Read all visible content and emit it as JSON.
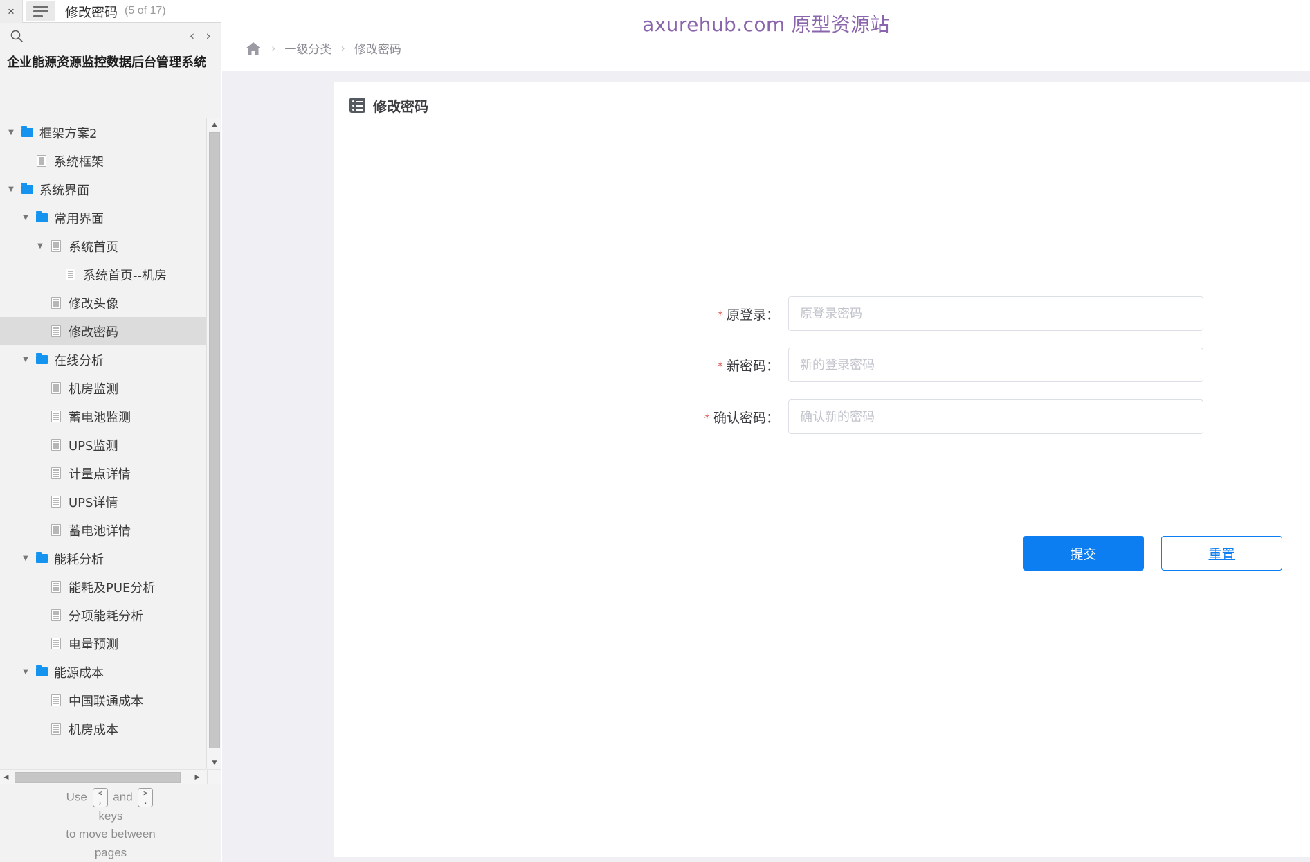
{
  "host": {
    "close_label": "×",
    "menu_icon": "hamburger-icon",
    "page_title": "修改密码",
    "page_count": "(5 of 17)",
    "prev_arrow": "‹",
    "next_arrow": "›",
    "search_icon": "search-icon"
  },
  "sidebar": {
    "app_title": "企业能源资源监控数据后台管理系统",
    "tree": [
      {
        "label": "框架方案2",
        "type": "folder",
        "depth": 0,
        "twisty": "▼",
        "selected": false
      },
      {
        "label": "系统框架",
        "type": "page",
        "depth": 1,
        "twisty": "",
        "selected": false
      },
      {
        "label": "系统界面",
        "type": "folder",
        "depth": 0,
        "twisty": "▼",
        "selected": false
      },
      {
        "label": "常用界面",
        "type": "folder",
        "depth": 1,
        "twisty": "▼",
        "selected": false
      },
      {
        "label": "系统首页",
        "type": "page",
        "depth": 2,
        "twisty": "▼",
        "selected": false
      },
      {
        "label": "系统首页--机房",
        "type": "page",
        "depth": 3,
        "twisty": "",
        "selected": false
      },
      {
        "label": "修改头像",
        "type": "page",
        "depth": 2,
        "twisty": "",
        "selected": false
      },
      {
        "label": "修改密码",
        "type": "page",
        "depth": 2,
        "twisty": "",
        "selected": true
      },
      {
        "label": "在线分析",
        "type": "folder",
        "depth": 1,
        "twisty": "▼",
        "selected": false
      },
      {
        "label": "机房监测",
        "type": "page",
        "depth": 2,
        "twisty": "",
        "selected": false
      },
      {
        "label": "蓄电池监测",
        "type": "page",
        "depth": 2,
        "twisty": "",
        "selected": false
      },
      {
        "label": "UPS监测",
        "type": "page",
        "depth": 2,
        "twisty": "",
        "selected": false
      },
      {
        "label": "计量点详情",
        "type": "page",
        "depth": 2,
        "twisty": "",
        "selected": false
      },
      {
        "label": "UPS详情",
        "type": "page",
        "depth": 2,
        "twisty": "",
        "selected": false
      },
      {
        "label": "蓄电池详情",
        "type": "page",
        "depth": 2,
        "twisty": "",
        "selected": false
      },
      {
        "label": "能耗分析",
        "type": "folder",
        "depth": 1,
        "twisty": "▼",
        "selected": false
      },
      {
        "label": "能耗及PUE分析",
        "type": "page",
        "depth": 2,
        "twisty": "",
        "selected": false
      },
      {
        "label": "分项能耗分析",
        "type": "page",
        "depth": 2,
        "twisty": "",
        "selected": false
      },
      {
        "label": "电量预测",
        "type": "page",
        "depth": 2,
        "twisty": "",
        "selected": false
      },
      {
        "label": "能源成本",
        "type": "folder",
        "depth": 1,
        "twisty": "▼",
        "selected": false
      },
      {
        "label": "中国联通成本",
        "type": "page",
        "depth": 2,
        "twisty": "",
        "selected": false
      },
      {
        "label": "机房成本",
        "type": "page",
        "depth": 2,
        "twisty": "",
        "selected": false
      }
    ],
    "footer": {
      "use": "Use",
      "key_prev_top": "<",
      "key_prev_bottom": ",",
      "and": "and",
      "key_next_top": ">",
      "key_next_bottom": ".",
      "keys": "keys",
      "line3": "to move between",
      "line4": "pages"
    },
    "scroll": {
      "up": "▲",
      "down": "▼",
      "left": "◀",
      "right": "▶"
    }
  },
  "watermark": "axurehub.com 原型资源站",
  "breadcrumb": {
    "home_icon": "home-icon",
    "separator": "›",
    "items": [
      "一级分类",
      "修改密码"
    ]
  },
  "card": {
    "icon": "list-icon",
    "title": "修改密码"
  },
  "form": {
    "required_mark": "*",
    "fields": [
      {
        "label": "原登录：",
        "placeholder": "原登录密码",
        "value": ""
      },
      {
        "label": "新密码：",
        "placeholder": "新的登录密码",
        "value": ""
      },
      {
        "label": "确认密码：",
        "placeholder": "确认新的密码",
        "value": ""
      }
    ],
    "submit_label": "提交",
    "reset_label": "重置"
  },
  "colors": {
    "accent": "#0c7ef2",
    "folder": "#1594ef",
    "required": "#d9534f",
    "watermark": "#8a64ac",
    "page_bg": "#f0f0f4"
  }
}
